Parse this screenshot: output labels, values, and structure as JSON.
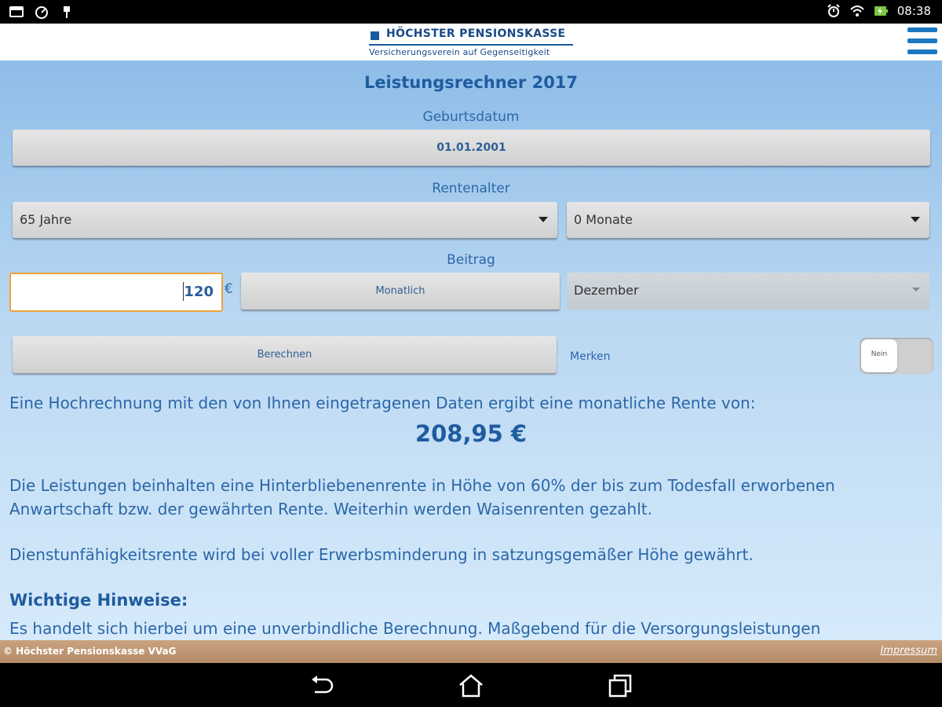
{
  "status_bar": {
    "time": "08:38",
    "left_icons": [
      "screen-icon",
      "speedometer-icon",
      "usb-icon"
    ],
    "right_icons": [
      "alarm-icon",
      "wifi-icon",
      "battery-charging-icon"
    ]
  },
  "header": {
    "logo_title": "HÖCHSTER PENSIONSKASSE",
    "logo_subtitle": "Versicherungsverein auf Gegenseitigkeit",
    "menu_icon": "hamburger-menu-icon"
  },
  "calculator": {
    "title": "Leistungsrechner 2017",
    "birthdate_label": "Geburtsdatum",
    "birthdate_value": "01.01.2001",
    "retirement_age_label": "Rentenalter",
    "retirement_years": "65 Jahre",
    "retirement_months": "0 Monate",
    "contribution_label": "Beitrag",
    "contribution_amount": "120",
    "currency": "€",
    "frequency_button": "Monatlich",
    "month_select": "Dezember",
    "calculate_button": "Berechnen",
    "remember_label": "Merken",
    "remember_toggle": "Nein"
  },
  "result": {
    "intro": "Eine Hochrechnung mit den von Ihnen eingetragenen Daten ergibt eine monatliche Rente von:",
    "value": "208,95 €",
    "paragraph1": "Die Leistungen beinhalten eine Hinterbliebenenrente in Höhe von 60% der bis zum Todesfall erworbenen Anwartschaft bzw. der gewährten Rente. Weiterhin werden Waisenrenten gezahlt.",
    "paragraph2": "Dienstunfähigkeitsrente wird bei voller Erwerbsminderung in satzungsgemäßer Höhe gewährt.",
    "notes_heading": "Wichtige Hinweise:",
    "notes_text": "Es handelt sich hierbei um eine unverbindliche Berechnung. Maßgebend für die Versorgungsleistungen"
  },
  "footer": {
    "copyright": "© Höchster Pensionskasse VVaG",
    "impressum": "Impressum"
  },
  "navigation": {
    "buttons": [
      "back-icon",
      "home-icon",
      "recent-apps-icon"
    ]
  },
  "colors": {
    "accent": "#1f5c9f",
    "text": "#2b67a8",
    "input_focus": "#f0a238",
    "footer": "#b48b68"
  }
}
